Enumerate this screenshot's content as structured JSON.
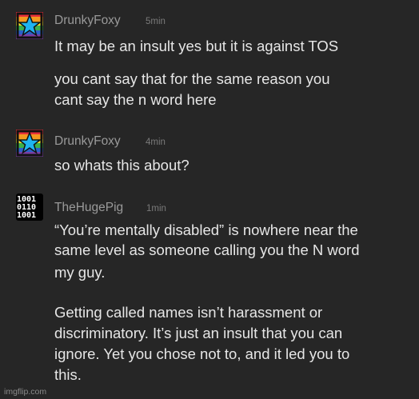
{
  "messages": [
    {
      "author": "DrunkyFoxy",
      "time": "5min",
      "avatar_icon": "rainbow-star-icon",
      "lines": [
        "It may be an insult yes but it is against TOS",
        "",
        "you cant say that for the same reason you",
        "cant say the n word here"
      ]
    },
    {
      "author": "DrunkyFoxy",
      "time": "4min",
      "avatar_icon": "rainbow-star-icon",
      "lines": [
        "so whats this about?"
      ]
    },
    {
      "author": "TheHugePig",
      "time": "1min",
      "avatar_icon": "binary-digits-icon",
      "lines": [
        "“You’re mentally disabled” is nowhere near the",
        "same level as someone calling you the N word",
        "my guy.",
        "",
        "Getting called names isn’t harassment or",
        "discriminatory. It’s just an insult that you can",
        "ignore. Yet you chose not to, and it led you to",
        "this."
      ]
    }
  ],
  "watermark": "imgflip.com",
  "colors": {
    "background": "#262626",
    "name": "#9a9a9a",
    "time": "#7a7a7a",
    "text": "#e6e6e6",
    "star": "#1fb4f0"
  }
}
